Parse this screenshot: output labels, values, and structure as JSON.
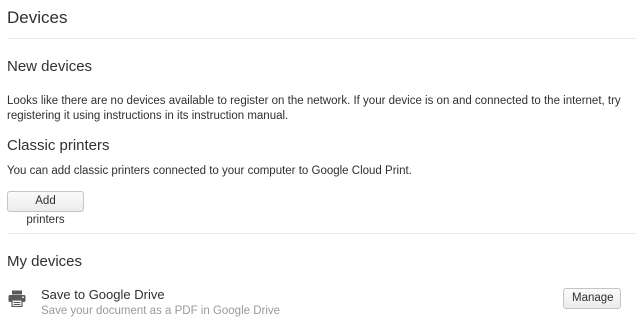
{
  "page": {
    "title": "Devices"
  },
  "new_devices": {
    "heading": "New devices",
    "description": "Looks like there are no devices available to register on the network. If your device is on and connected to the internet, try registering it using instructions in its instruction manual."
  },
  "classic_printers": {
    "heading": "Classic printers",
    "description": "You can add classic printers connected to your computer to Google Cloud Print.",
    "add_button_label": "Add printers"
  },
  "my_devices": {
    "heading": "My devices",
    "items": [
      {
        "icon": "printer-icon",
        "name": "Save to Google Drive",
        "description": "Save your document as a PDF in Google Drive",
        "action_label": "Manage"
      }
    ]
  }
}
